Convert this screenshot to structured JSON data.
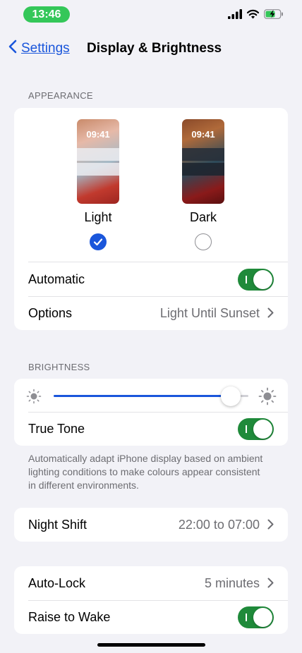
{
  "status_bar": {
    "time": "13:46"
  },
  "nav": {
    "back_label": "Settings",
    "title": "Display & Brightness"
  },
  "appearance": {
    "header": "APPEARANCE",
    "light": {
      "preview_time": "09:41",
      "label": "Light",
      "selected": true
    },
    "dark": {
      "preview_time": "09:41",
      "label": "Dark",
      "selected": false
    },
    "automatic": {
      "label": "Automatic",
      "on": true
    },
    "options": {
      "label": "Options",
      "value": "Light Until Sunset"
    }
  },
  "brightness": {
    "header": "BRIGHTNESS",
    "level": 0.91,
    "true_tone": {
      "label": "True Tone",
      "on": true
    },
    "footer": "Automatically adapt iPhone display based on ambient lighting conditions to make colours appear consistent in different environments."
  },
  "night_shift": {
    "label": "Night Shift",
    "value": "22:00 to 07:00"
  },
  "auto_lock": {
    "label": "Auto-Lock",
    "value": "5 minutes"
  },
  "raise_to_wake": {
    "label": "Raise to Wake",
    "on": true
  },
  "colors": {
    "accent": "#1a56db",
    "toggle_on": "#1f8a3a",
    "status_pill": "#34c759"
  }
}
